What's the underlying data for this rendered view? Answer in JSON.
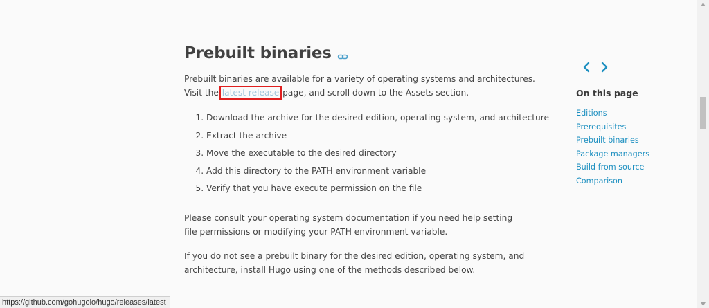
{
  "main": {
    "title": "Prebuilt binaries",
    "intro": {
      "line1": "Prebuilt binaries are available for a variety of operating systems and architectures.",
      "before_link": "Visit the ",
      "link_text": "latest release",
      "after_link": " page, and scroll down to the Assets section."
    },
    "steps": [
      "Download the archive for the desired edition, operating system, and architecture",
      "Extract the archive",
      "Move the executable to the desired directory",
      "Add this directory to the PATH environment variable",
      "Verify that you have execute permission on the file"
    ],
    "consult": "Please consult your operating system documentation if you need help setting file permissions or modifying your PATH environment variable.",
    "if_not": "If you do not see a prebuilt binary for the desired edition, operating system, and architecture, install Hugo using one of the methods described below."
  },
  "toc": {
    "title": "On this page",
    "items": [
      "Editions",
      "Prerequisites",
      "Prebuilt binaries",
      "Package managers",
      "Build from source",
      "Comparison"
    ]
  },
  "nav": {
    "prev_icon": "chevron-left-icon",
    "next_icon": "chevron-right-icon"
  },
  "status_bar": {
    "url": "https://github.com/gohugoio/hugo/releases/latest"
  },
  "colors": {
    "link": "#1c8fc0",
    "highlight_box": "#e01e1e",
    "highlighted_link": "#9fc5da",
    "text": "#444444"
  }
}
